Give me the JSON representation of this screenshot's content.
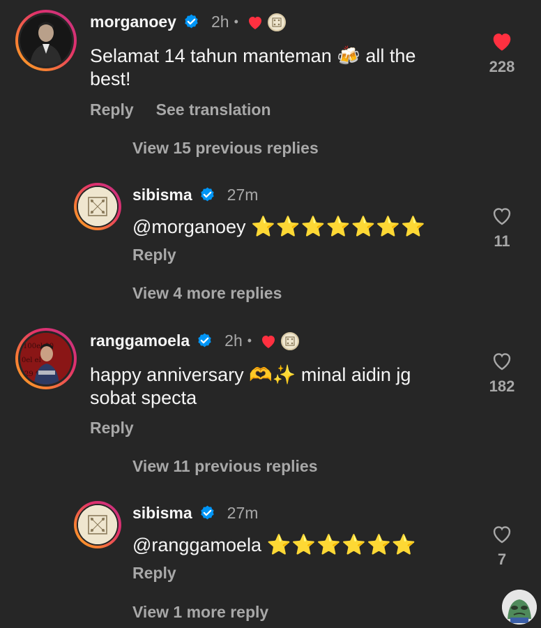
{
  "comments": [
    {
      "username": "morganoey",
      "time": "2h",
      "dot": "•",
      "text_line1": "Selamat 14 tahun manteman 🍻 all the",
      "text_line2": "best!",
      "reply_label": "Reply",
      "translate_label": "See translation",
      "likes": "228",
      "liked": true,
      "view_replies": "View 15 previous replies"
    },
    {
      "username": "sibisma",
      "time": "27m",
      "mention": "@morganoey",
      "stars": "⭐⭐⭐⭐⭐⭐⭐",
      "reply_label": "Reply",
      "likes": "11",
      "liked": false,
      "view_replies": "View 4 more replies"
    },
    {
      "username": "ranggamoela",
      "time": "2h",
      "dot": "•",
      "text_line1": "happy anniversary 🫶✨ minal aidin jg",
      "text_line2": "sobat specta",
      "reply_label": "Reply",
      "likes": "182",
      "liked": false,
      "view_replies": "View 11 previous replies"
    },
    {
      "username": "sibisma",
      "time": "27m",
      "mention": "@ranggamoela",
      "stars": "⭐⭐⭐⭐⭐⭐",
      "reply_label": "Reply",
      "likes": "7",
      "liked": false,
      "view_replies": "View 1 more reply"
    }
  ],
  "colors": {
    "background": "#262626",
    "verified": "#0095f6",
    "liked_heart": "#ff3040",
    "secondary_text": "#a8a8a8"
  },
  "icons": {
    "verified": "verified-badge-icon",
    "heart_filled": "heart-filled-icon",
    "heart_outline": "heart-outline-icon"
  }
}
